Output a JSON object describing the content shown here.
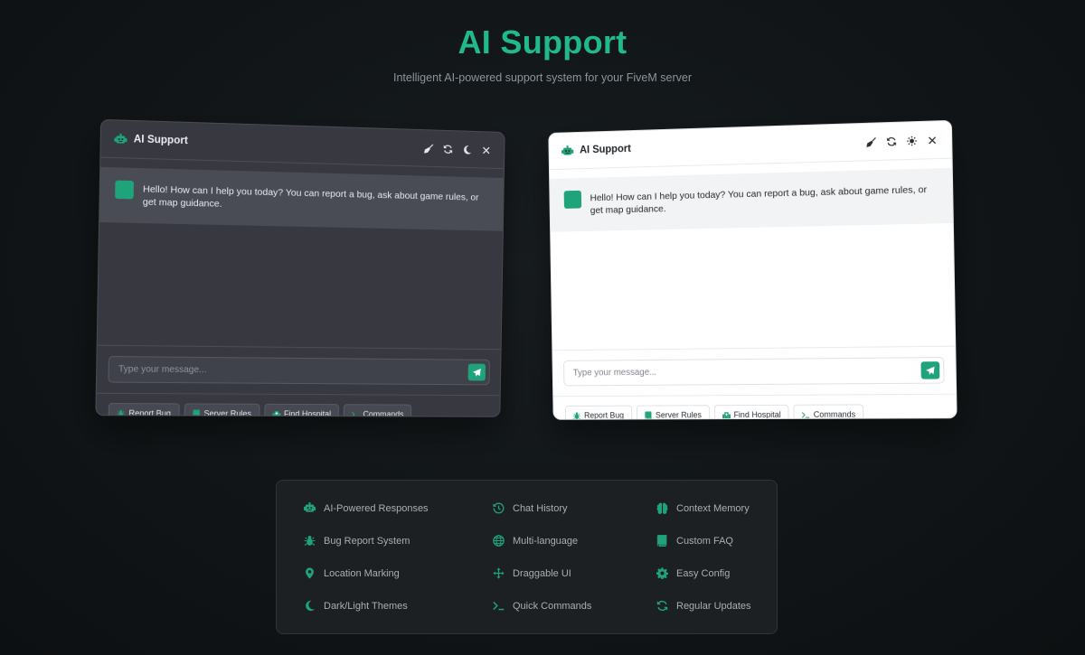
{
  "hero": {
    "title": "AI Support",
    "subtitle": "Intelligent AI-powered support system for your FiveM server"
  },
  "colors": {
    "accent": "#1fa37a",
    "title_accent": "#1fb98b",
    "dark_window_bg": "#373840",
    "light_window_bg": "#ffffff"
  },
  "dark_window": {
    "title": "AI Support",
    "header_icons": [
      "broom-icon",
      "refresh-icon",
      "moon-icon",
      "close-icon"
    ],
    "message": "Hello! How can I help you today? You can report a bug, ask about game rules, or get map guidance.",
    "input_placeholder": "Type your message...",
    "quick_buttons": [
      {
        "label": "Report Bug",
        "icon": "bug-icon"
      },
      {
        "label": "Server Rules",
        "icon": "book-icon"
      },
      {
        "label": "Find Hospital",
        "icon": "hospital-icon"
      },
      {
        "label": "Commands",
        "icon": "terminal-icon"
      }
    ]
  },
  "light_window": {
    "title": "AI Support",
    "header_icons": [
      "broom-icon",
      "refresh-icon",
      "sun-icon",
      "close-icon"
    ],
    "message": "Hello! How can I help you today? You can report a bug, ask about game rules, or get map guidance.",
    "input_placeholder": "Type your message...",
    "quick_buttons": [
      {
        "label": "Report Bug",
        "icon": "bug-icon"
      },
      {
        "label": "Server Rules",
        "icon": "book-icon"
      },
      {
        "label": "Find Hospital",
        "icon": "hospital-icon"
      },
      {
        "label": "Commands",
        "icon": "terminal-icon"
      }
    ]
  },
  "features": [
    {
      "label": "AI-Powered Responses",
      "icon": "robot-icon"
    },
    {
      "label": "Chat History",
      "icon": "history-icon"
    },
    {
      "label": "Context Memory",
      "icon": "brain-icon"
    },
    {
      "label": "Bug Report System",
      "icon": "bug-icon"
    },
    {
      "label": "Multi-language",
      "icon": "globe-icon"
    },
    {
      "label": "Custom FAQ",
      "icon": "book-icon"
    },
    {
      "label": "Location Marking",
      "icon": "map-pin-icon"
    },
    {
      "label": "Draggable UI",
      "icon": "move-arrows-icon"
    },
    {
      "label": "Easy Config",
      "icon": "gear-icon"
    },
    {
      "label": "Dark/Light Themes",
      "icon": "moon-icon"
    },
    {
      "label": "Quick Commands",
      "icon": "terminal-icon"
    },
    {
      "label": "Regular Updates",
      "icon": "refresh-icon"
    }
  ]
}
